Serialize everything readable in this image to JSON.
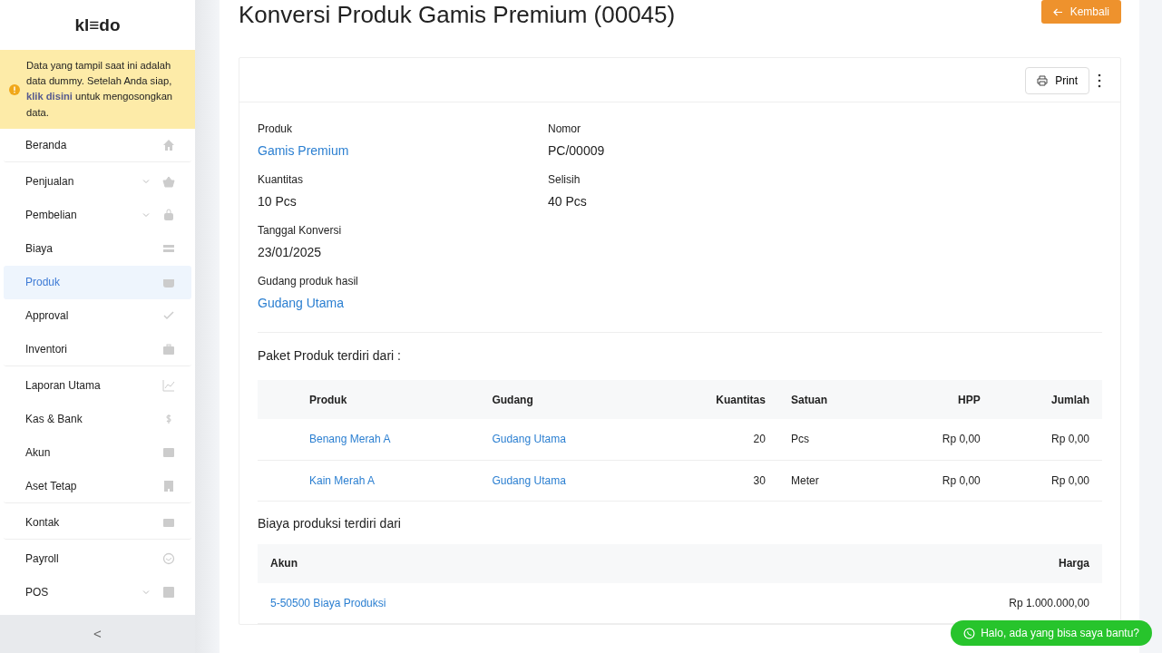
{
  "logo": "kl≡do",
  "notice": {
    "text": "Data yang tampil saat ini adalah data dummy. Setelah Anda siap, ",
    "link": "klik disini",
    "after": " untuk mengosongkan data."
  },
  "sidebar": {
    "items": [
      {
        "label": "Beranda",
        "selected": false,
        "expandable": false,
        "group_end": true
      },
      {
        "label": "Penjualan",
        "selected": false,
        "expandable": true,
        "group_end": false
      },
      {
        "label": "Pembelian",
        "selected": false,
        "expandable": true,
        "group_end": false
      },
      {
        "label": "Biaya",
        "selected": false,
        "expandable": false,
        "group_end": false
      },
      {
        "label": "Produk",
        "selected": true,
        "expandable": false,
        "group_end": false
      },
      {
        "label": "Approval",
        "selected": false,
        "expandable": false,
        "group_end": false
      },
      {
        "label": "Inventori",
        "selected": false,
        "expandable": false,
        "group_end": true
      },
      {
        "label": "Laporan Utama",
        "selected": false,
        "expandable": false,
        "group_end": false
      },
      {
        "label": "Kas & Bank",
        "selected": false,
        "expandable": false,
        "group_end": false
      },
      {
        "label": "Akun",
        "selected": false,
        "expandable": false,
        "group_end": false
      },
      {
        "label": "Aset Tetap",
        "selected": false,
        "expandable": false,
        "group_end": true
      },
      {
        "label": "Kontak",
        "selected": false,
        "expandable": false,
        "group_end": true
      },
      {
        "label": "Payroll",
        "selected": false,
        "expandable": false,
        "group_end": false
      },
      {
        "label": "POS",
        "selected": false,
        "expandable": true,
        "group_end": false
      }
    ],
    "collapse": "<"
  },
  "title": "Konversi Produk Gamis Premium (00045)",
  "back_button": "Kembali",
  "print_button": "Print",
  "fields": [
    {
      "label": "Produk",
      "value": "Gamis Premium",
      "kind": "link"
    },
    {
      "label": "Nomor",
      "value": "PC/00009",
      "kind": "text"
    },
    {
      "label": "Kuantitas",
      "value": "10 Pcs",
      "kind": "text"
    },
    {
      "label": "Selisih",
      "value": "40 Pcs",
      "kind": "text"
    },
    {
      "label": "Tanggal Konversi",
      "value": "23/01/2025",
      "kind": "text"
    },
    {
      "label": "Gudang produk hasil",
      "value": "Gudang Utama",
      "kind": "link"
    }
  ],
  "package": {
    "heading": "Paket Produk terdiri dari :",
    "columns": [
      "Produk",
      "Gudang",
      "Kuantitas",
      "Satuan",
      "HPP",
      "Jumlah"
    ],
    "rows": [
      [
        "Benang Merah A",
        "Gudang Utama",
        "20",
        "Pcs",
        "Rp 0,00",
        "Rp 0,00"
      ],
      [
        "Kain Merah A",
        "Gudang Utama",
        "30",
        "Meter",
        "Rp 0,00",
        "Rp 0,00"
      ]
    ]
  },
  "costs": {
    "heading": "Biaya produksi terdiri dari",
    "columns": [
      "Akun",
      "Harga"
    ],
    "rows": [
      [
        "5-50500 Biaya Produksi",
        "Rp 1.000.000,00"
      ]
    ]
  },
  "chat_button": "Halo, ada yang bisa saya bantu?"
}
